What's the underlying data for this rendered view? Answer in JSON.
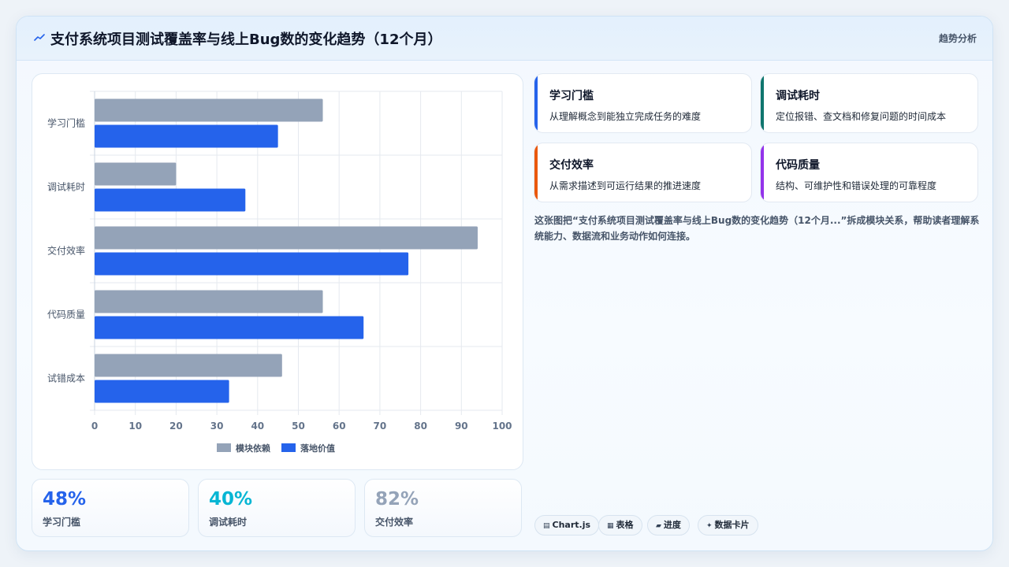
{
  "header": {
    "title": "支付系统项目测试覆盖率与线上Bug数的变化趋势（12个月）",
    "link": "趋势分析"
  },
  "chart_data": {
    "type": "bar",
    "orientation": "horizontal",
    "categories": [
      "学习门槛",
      "调试耗时",
      "交付效率",
      "代码质量",
      "试错成本"
    ],
    "series": [
      {
        "name": "模块依赖",
        "color": "#94a3b8",
        "values": [
          56,
          20,
          94,
          56,
          46
        ]
      },
      {
        "name": "落地价值",
        "color": "#2563eb",
        "values": [
          45,
          37,
          77,
          66,
          33
        ]
      }
    ],
    "xlim": [
      0,
      100
    ],
    "xticks": [
      0,
      10,
      20,
      30,
      40,
      50,
      60,
      70,
      80,
      90,
      100
    ],
    "grid": true,
    "legend": "bottom"
  },
  "stats": [
    {
      "value": "48%",
      "label": "学习门槛",
      "color": "#2563eb"
    },
    {
      "value": "40%",
      "label": "调试耗时",
      "color": "#06b6d4"
    },
    {
      "value": "82%",
      "label": "交付效率",
      "color": "#94a3b8"
    }
  ],
  "cards": [
    {
      "title": "学习门槛",
      "desc": "从理解概念到能独立完成任务的难度",
      "color": "#2563eb"
    },
    {
      "title": "调试耗时",
      "desc": "定位报错、查文档和修复问题的时间成本",
      "color": "#0f766e"
    },
    {
      "title": "交付效率",
      "desc": "从需求描述到可运行结果的推进速度",
      "color": "#ea580c"
    },
    {
      "title": "代码质量",
      "desc": "结构、可维护性和错误处理的可靠程度",
      "color": "#9333ea"
    }
  ],
  "description": "这张图把“支付系统项目测试覆盖率与线上Bug数的变化趋势（12个月...”拆成模块关系，帮助读者理解系统能力、数据流和业务动作如何连接。",
  "tags": [
    {
      "icon": "chart-icon",
      "glyph": "▤",
      "label": "Chart.js"
    },
    {
      "icon": "table-icon",
      "glyph": "▦",
      "label": "表格"
    },
    {
      "icon": "progress-icon",
      "glyph": "▰",
      "label": "进度"
    },
    {
      "icon": "sparkle-icon",
      "glyph": "✦",
      "label": "数据卡片"
    }
  ]
}
